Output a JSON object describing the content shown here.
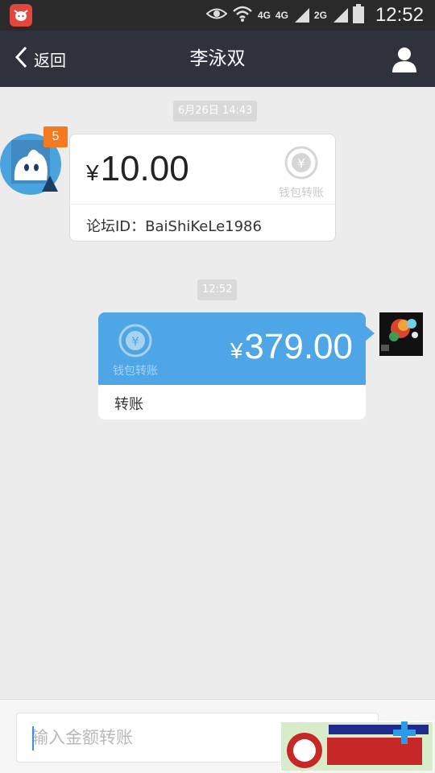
{
  "status_bar": {
    "network_1": "4G",
    "network_2": "4G",
    "network_3": "2G",
    "time": "12:52"
  },
  "header": {
    "back_label": "返回",
    "title": "李泳双",
    "icons": {
      "back": "chevron-left-icon",
      "profile": "person-icon"
    }
  },
  "chat": {
    "messages": [
      {
        "timestamp": "6月26日 14:43",
        "direction": "received",
        "unread_badge": "5",
        "currency": "¥",
        "amount": "10.00",
        "watermark": "钱包转账",
        "note": "论坛ID：BaiShiKeLe1986"
      },
      {
        "timestamp": "12:52",
        "direction": "sent",
        "currency": "¥",
        "amount": "379.00",
        "watermark": "钱包转账",
        "note": "转账"
      }
    ]
  },
  "input": {
    "placeholder": "输入金额转账",
    "value": ""
  },
  "colors": {
    "status_bar": "#2a2a2a",
    "header": "#2e323d",
    "chat_bg": "#ececec",
    "sent_card": "#4fa6e6",
    "badge": "#f47a20",
    "caret": "#3b8df0"
  }
}
